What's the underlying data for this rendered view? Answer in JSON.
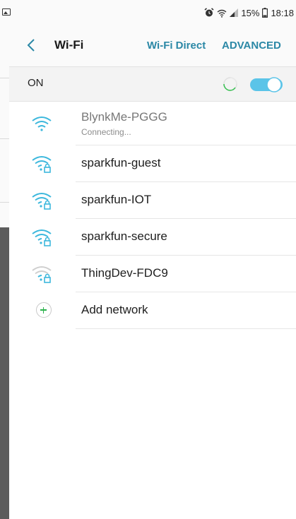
{
  "status_bar": {
    "battery_percent": "15%",
    "time": "18:18",
    "icons": [
      "image-icon",
      "alarm-icon",
      "wifi-icon",
      "signal-icon",
      "battery-icon"
    ]
  },
  "app_bar": {
    "title": "Wi-Fi",
    "wifi_direct_label": "Wi-Fi Direct",
    "advanced_label": "ADVANCED",
    "accent_color": "#2b88a6"
  },
  "wifi_toggle": {
    "label": "ON",
    "state": "on",
    "toggle_color": "#5bc4e8"
  },
  "networks": [
    {
      "name": "BlynkMe-PGGG",
      "status": "Connecting...",
      "secured": false,
      "signal": "full",
      "icon": "wifi-icon"
    },
    {
      "name": "sparkfun-guest",
      "secured": true,
      "signal": "full",
      "icon": "wifi-lock-icon"
    },
    {
      "name": "sparkfun-IOT",
      "secured": true,
      "signal": "full",
      "icon": "wifi-lock-icon"
    },
    {
      "name": "sparkfun-secure",
      "secured": true,
      "signal": "full",
      "icon": "wifi-lock-icon"
    },
    {
      "name": "ThingDev-FDC9",
      "secured": true,
      "signal": "weak",
      "icon": "wifi-lock-icon"
    }
  ],
  "add_network": {
    "label": "Add network",
    "icon": "plus-circle-icon",
    "icon_color": "#2bb24c"
  }
}
